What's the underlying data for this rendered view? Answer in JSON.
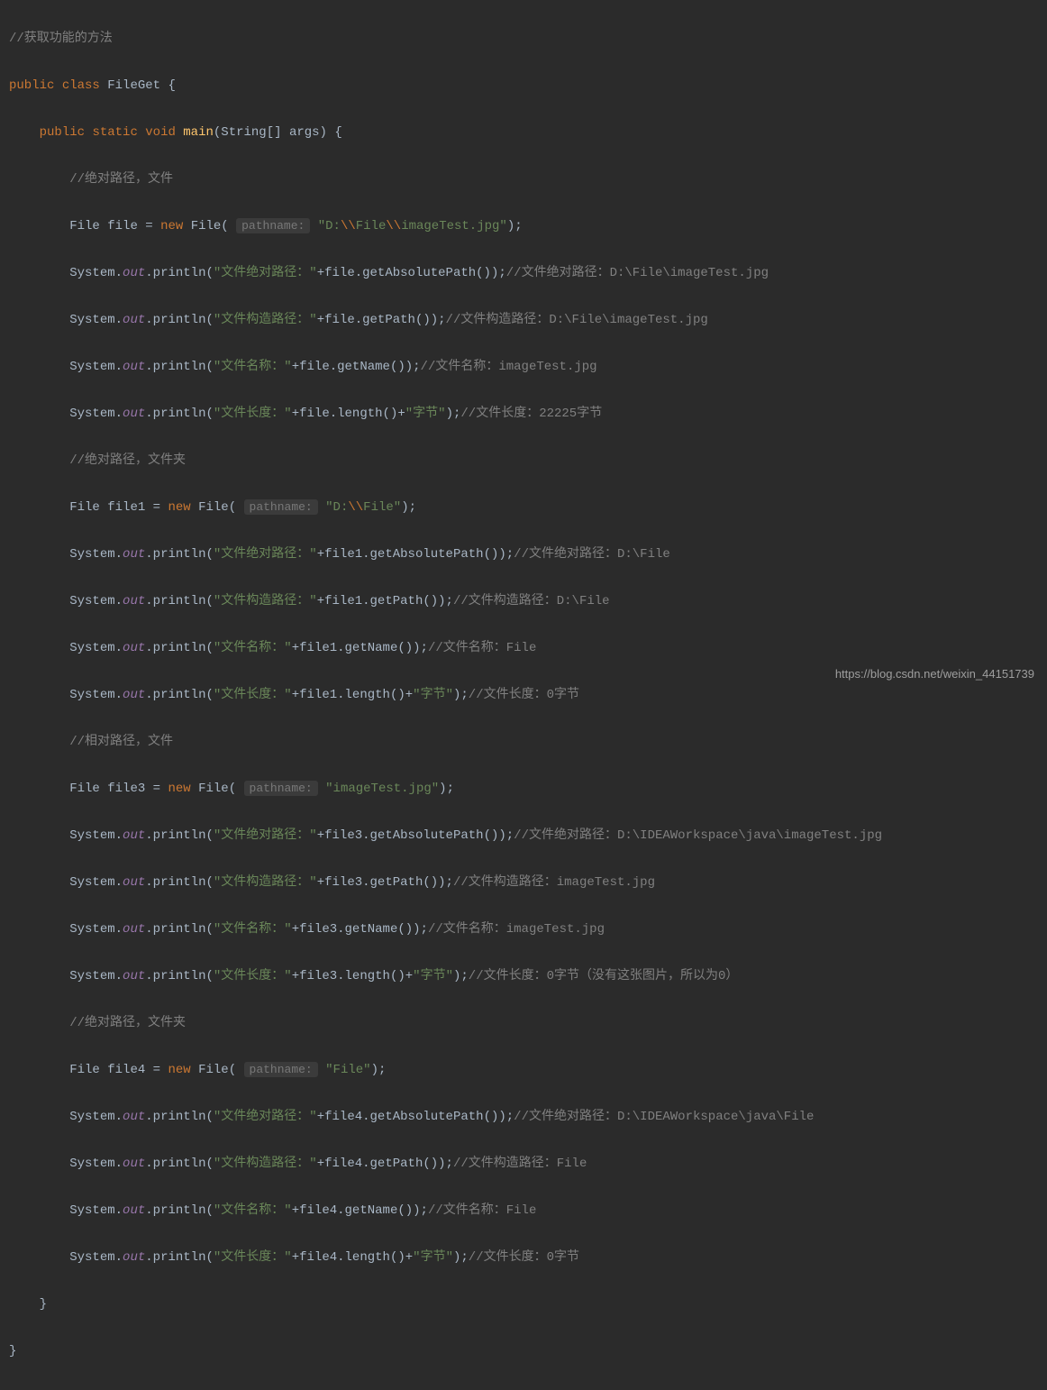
{
  "watermark": "https://blog.csdn.net/weixin_44151739",
  "code": {
    "c1": "//获取功能的方法",
    "kw_public": "public",
    "kw_class": "class",
    "kw_static": "static",
    "kw_void": "void",
    "kw_new": "new",
    "cls_FileGet": "FileGet",
    "m_main": "main",
    "p_String": "String",
    "p_args": "args",
    "c2": "//绝对路径，文件",
    "t_File": "File",
    "v_file": "file",
    "v_file1": "file1",
    "v_file3": "file3",
    "v_file4": "file4",
    "hint_pathname": "pathname:",
    "s_path1a": "\"D:",
    "s_esc": "\\\\",
    "s_path1b": "File",
    "s_path1c": "imageTest.jpg\"",
    "t_System": "System",
    "f_out": "out",
    "m_println": "println",
    "s_abs": "\"文件绝对路径：\"",
    "s_con": "\"文件构造路径：\"",
    "s_name": "\"文件名称：\"",
    "s_len": "\"文件长度：\"",
    "s_byte": "\"字节\"",
    "m_getAbsPath": "getAbsolutePath",
    "m_getPath": "getPath",
    "m_getName": "getName",
    "m_length": "length",
    "c_abs1": "//文件绝对路径：D:\\File\\imageTest.jpg",
    "c_con1": "//文件构造路径：D:\\File\\imageTest.jpg",
    "c_name1": "//文件名称：imageTest.jpg",
    "c_len1": "//文件长度：22225字节",
    "c3": "//绝对路径，文件夹",
    "s_path2a": "\"D:",
    "s_path2b": "File\"",
    "c_abs2": "//文件绝对路径：D:\\File",
    "c_con2": "//文件构造路径：D:\\File",
    "c_name2": "//文件名称：File",
    "c_len2": "//文件长度：0字节",
    "c4": "//相对路径，文件",
    "s_path3": "\"imageTest.jpg\"",
    "c_abs3": "//文件绝对路径：D:\\IDEAWorkspace\\java\\imageTest.jpg",
    "c_con3": "//文件构造路径：imageTest.jpg",
    "c_name3": "//文件名称：imageTest.jpg",
    "c_len3": "//文件长度：0字节（没有这张图片，所以为0）",
    "c5": "//绝对路径，文件夹",
    "s_path4": "\"File\"",
    "c_abs4": "//文件绝对路径：D:\\IDEAWorkspace\\java\\File",
    "c_con4": "//文件构造路径：File",
    "c_name4": "//文件名称：File",
    "c_len4": "//文件长度：0字节"
  }
}
